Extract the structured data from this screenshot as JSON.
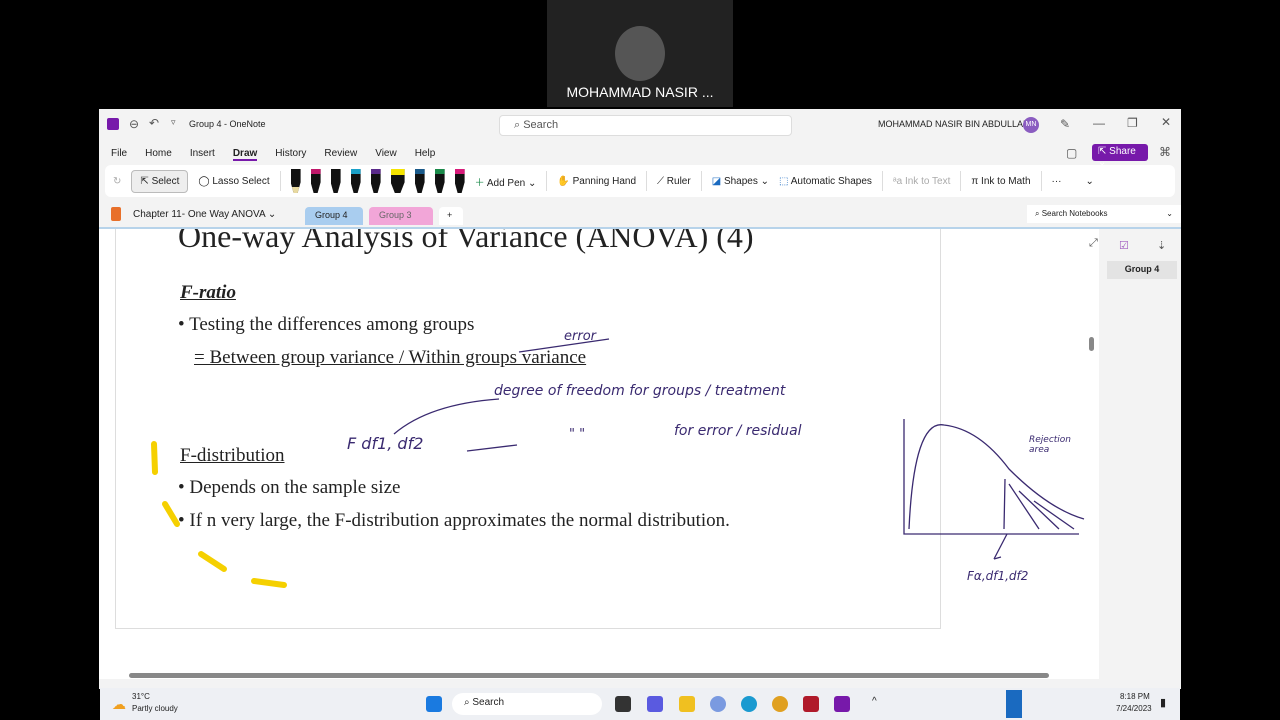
{
  "video": {
    "participant": "MOHAMMAD NASIR ..."
  },
  "window": {
    "title": "Group 4 - OneNote",
    "search_placeholder": "Search",
    "user": "MOHAMMAD NASIR BIN ABDULLAH",
    "avatar": "MN"
  },
  "menu": [
    "File",
    "Home",
    "Insert",
    "Draw",
    "History",
    "Review",
    "View",
    "Help"
  ],
  "share": "Share",
  "ribbon": {
    "select": "Select",
    "lasso": "Lasso Select",
    "add_pen": "Add Pen",
    "panning": "Panning Hand",
    "ruler": "Ruler",
    "shapes": "Shapes",
    "auto_shapes": "Automatic Shapes",
    "ink_text": "Ink to Text",
    "ink_math": "Ink to Math",
    "more": "···",
    "pens": [
      "#e8d9a0",
      "#c0186a",
      "#111111",
      "#1aa0c8",
      "#5a2a8a",
      "#f5e400",
      "#1a5a8a",
      "#1a8a4a",
      "#d81b7a"
    ]
  },
  "notebook": {
    "section": "Chapter 11- One Way ANOVA",
    "tabs": [
      "Group 4",
      "Group 3"
    ],
    "add": "+",
    "search_notebooks": "Search Notebooks"
  },
  "slide": {
    "title": "One-way Analysis of Variance (ANOVA) (4)",
    "h1": "F-ratio",
    "b1": "Testing the differences among groups",
    "b2": "= Between group variance / Within groups variance",
    "h2": "F-distribution",
    "b3": "Depends on the sample size",
    "b4": "If n very large, the F-distribution approximates the normal  distribution."
  },
  "ink": {
    "error": "error",
    "dof": "degree of freedom for groups / treatment",
    "fdf": "F df1, df2",
    "ditto": "\"   \"",
    "err_res": "for error / residual",
    "rejection": "Rejection area",
    "falpha": "Fα,df1,df2"
  },
  "pages": [
    "Group 4"
  ],
  "taskbar": {
    "temp": "31°C",
    "weather": "Partly cloudy",
    "search": "Search",
    "time": "8:18 PM",
    "date": "7/24/2023"
  }
}
